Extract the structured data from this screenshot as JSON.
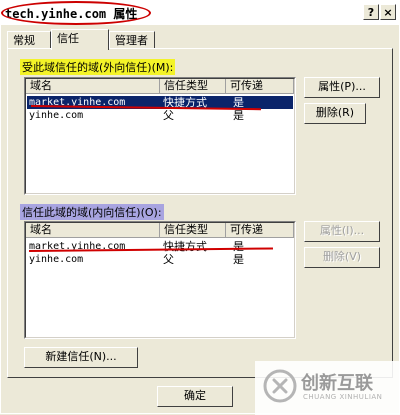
{
  "window": {
    "title": "tech.yinhe.com 属性",
    "help_label": "?",
    "close_label": "×"
  },
  "tabs": [
    {
      "label": "常规"
    },
    {
      "label": "信任"
    },
    {
      "label": "管理者"
    }
  ],
  "outgoing": {
    "label": "受此域信任的域(外向信任)(M):",
    "columns": [
      "域名",
      "信任类型",
      "可传递"
    ],
    "rows": [
      {
        "domain": "market.yinhe.com",
        "type": "快捷方式",
        "transitive": "是"
      },
      {
        "domain": "yinhe.com",
        "type": "父",
        "transitive": "是"
      }
    ],
    "properties_button": "属性(P)...",
    "remove_button": "删除(R)"
  },
  "incoming": {
    "label": "信任此域的域(内向信任)(O):",
    "columns": [
      "域名",
      "信任类型",
      "可传递"
    ],
    "rows": [
      {
        "domain": "market.yinhe.com",
        "type": "快捷方式",
        "transitive": "是"
      },
      {
        "domain": "yinhe.com",
        "type": "父",
        "transitive": "是"
      }
    ],
    "properties_button": "属性(I)...",
    "remove_button": "删除(V)"
  },
  "new_trust_button": "新建信任(N)...",
  "ok_button": "确定",
  "watermark": {
    "text": "创新互联",
    "sub": "CHUANG XINHULIAN"
  },
  "colors": {
    "annotation": "#d00000",
    "selection": "#0a246a",
    "outgoing_highlight": "#f3f328",
    "incoming_highlight": "#a8a4e0"
  }
}
